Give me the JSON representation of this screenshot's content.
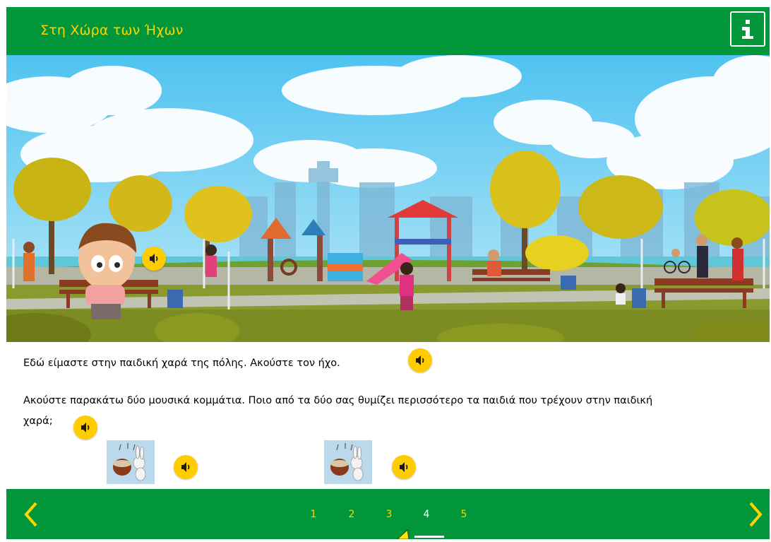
{
  "header": {
    "title": "Στη Χώρα των Ήχων",
    "info_icon": "info-icon"
  },
  "colors": {
    "brand_green": "#009639",
    "accent_yellow": "#ffd200",
    "sound_button": "#ffcc00"
  },
  "content": {
    "intro_text": "Εδώ είμαστε στην παιδική χαρά της πόλης. Ακούστε τον ήχο.",
    "question_line1": "Ακούστε παρακάτω δύο μουσικά κομμάτια. Ποιο από τα δύο σας θυμίζει περισσότερο τα παιδιά που τρέχουν στην παιδική",
    "question_line2": "χαρά;"
  },
  "pagination": {
    "pages": [
      "1",
      "2",
      "3",
      "4",
      "5"
    ],
    "current": "4",
    "prev_icon": "chevron-left-icon",
    "next_icon": "chevron-right-icon"
  }
}
